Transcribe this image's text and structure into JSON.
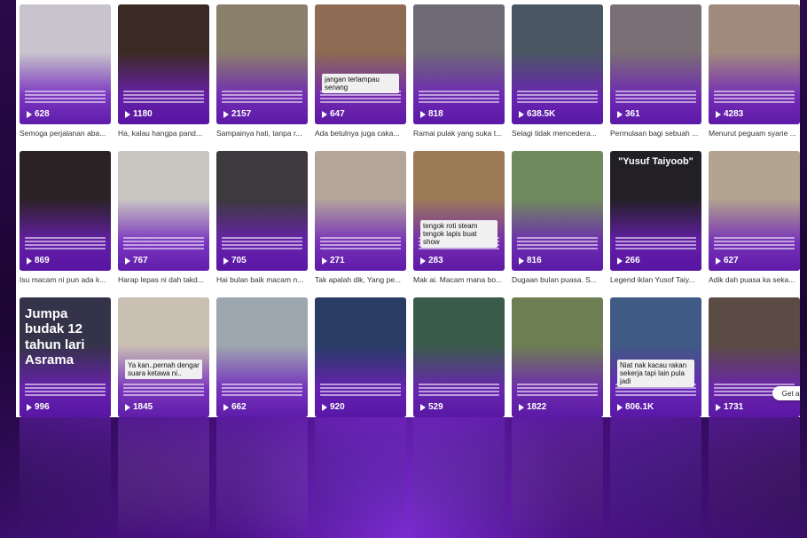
{
  "videos": [
    {
      "plays": "628",
      "caption": "Semoga perjalanan aba...",
      "bg": "#c8c3cc",
      "overlay": "",
      "chip": ""
    },
    {
      "plays": "1180",
      "caption": "Ha, kalau hangpa pand...",
      "bg": "#3b2a24",
      "overlay": "",
      "chip": ""
    },
    {
      "plays": "2157",
      "caption": "Sampainya hati, tanpa r...",
      "bg": "#8a7f6b",
      "overlay": "",
      "chip": ""
    },
    {
      "plays": "647",
      "caption": "Ada betulnya juga caka...",
      "bg": "#8e6b52",
      "overlay": "",
      "chip": "jangan terlampau senang"
    },
    {
      "plays": "818",
      "caption": "Ramai pulak yang suka t...",
      "bg": "#6d6a76",
      "overlay": "",
      "chip": ""
    },
    {
      "plays": "638.5K",
      "caption": "Selagi tidak mencedera...",
      "bg": "#4a5662",
      "overlay": "",
      "chip": ""
    },
    {
      "plays": "361",
      "caption": "Permulaan bagi sebuah ...",
      "bg": "#7a6f74",
      "overlay": "",
      "chip": ""
    },
    {
      "plays": "4283",
      "caption": "Menurut peguam syarie ...",
      "bg": "#a18a7d",
      "overlay": "",
      "chip": ""
    },
    {
      "plays": "869",
      "caption": "Isu macam ni pun ada k...",
      "bg": "#2b2226",
      "overlay": "",
      "chip": ""
    },
    {
      "plays": "767",
      "caption": "Harap lepas ni dah takd...",
      "bg": "#c9c6c2",
      "overlay": "",
      "chip": ""
    },
    {
      "plays": "705",
      "caption": "Hai bulan baik macam n...",
      "bg": "#3c3a3d",
      "overlay": "",
      "chip": ""
    },
    {
      "plays": "271",
      "caption": "Tak apalah dik, Yang pe...",
      "bg": "#b3a59a",
      "overlay": "",
      "chip": ""
    },
    {
      "plays": "283",
      "caption": "Mak ai. Macam mana bo...",
      "bg": "#9c7a56",
      "overlay": "",
      "chip": "tengok roti steam tengok lapis buat show"
    },
    {
      "plays": "816",
      "caption": "Dugaan bulan puasa. S...",
      "bg": "#6f8a5c",
      "overlay": "",
      "chip": ""
    },
    {
      "plays": "266",
      "caption": "Legend iklan Yusof Taiy...",
      "bg": "#222025",
      "overlay": "\"Yusuf Taiyoob\"",
      "chip": ""
    },
    {
      "plays": "627",
      "caption": "Adik dah puasa ka seka...",
      "bg": "#b2a48e",
      "overlay": "",
      "chip": ""
    },
    {
      "plays": "996",
      "caption": "",
      "bg": "#35334a",
      "overlay": "Jumpa budak 12 tahun lari Asrama",
      "chip": ""
    },
    {
      "plays": "1845",
      "caption": "",
      "bg": "#c9bfb3",
      "overlay": "",
      "chip": "Ya kan..pernah dengar suara ketawa ni.."
    },
    {
      "plays": "662",
      "caption": "",
      "bg": "#9da7b0",
      "overlay": "",
      "chip": ""
    },
    {
      "plays": "920",
      "caption": "",
      "bg": "#283c64",
      "overlay": "",
      "chip": ""
    },
    {
      "plays": "529",
      "caption": "",
      "bg": "#3a5b4a",
      "overlay": "",
      "chip": ""
    },
    {
      "plays": "1822",
      "caption": "",
      "bg": "#6d7f52",
      "overlay": "",
      "chip": ""
    },
    {
      "plays": "806.1K",
      "caption": "",
      "bg": "#3f5a84",
      "overlay": "",
      "chip": "Niat nak kacau rakan sekerja tapi lain pula jadi"
    },
    {
      "plays": "1731",
      "caption": "",
      "bg": "#5b4b45",
      "overlay": "",
      "chip": ""
    }
  ],
  "ui": {
    "get_app": "Get app"
  }
}
